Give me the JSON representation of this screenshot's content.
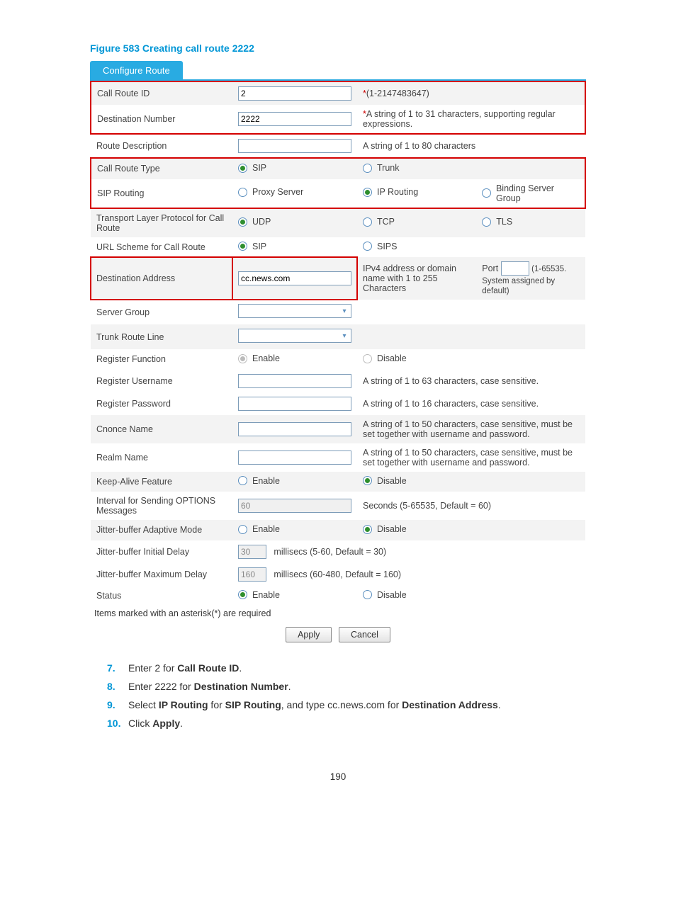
{
  "figure_title": "Figure 583 Creating call route 2222",
  "tab_label": "Configure Route",
  "rows": {
    "call_route_id": {
      "label": "Call Route ID",
      "value": "2",
      "hint_prefix": "*",
      "hint": "(1-2147483647)"
    },
    "dest_number": {
      "label": "Destination Number",
      "value": "2222",
      "hint_prefix": "*",
      "hint": "A string of 1 to 31 characters, supporting regular expressions."
    },
    "route_desc": {
      "label": "Route Description",
      "value": "",
      "hint": "A string of 1 to 80 characters"
    },
    "call_route_type": {
      "label": "Call Route Type",
      "opt1": "SIP",
      "opt2": "Trunk",
      "selected": "SIP"
    },
    "sip_routing": {
      "label": "SIP Routing",
      "opt1": "Proxy Server",
      "opt2": "IP Routing",
      "opt3": "Binding Server Group",
      "selected": "IP Routing"
    },
    "transport": {
      "label": "Transport Layer Protocol for Call Route",
      "opt1": "UDP",
      "opt2": "TCP",
      "opt3": "TLS",
      "selected": "UDP"
    },
    "url_scheme": {
      "label": "URL Scheme for Call Route",
      "opt1": "SIP",
      "opt2": "SIPS",
      "selected": "SIP"
    },
    "dest_addr": {
      "label": "Destination Address",
      "value": "cc.news.com",
      "hint": "IPv4 address or domain name with 1 to 255 Characters",
      "port_label": "Port",
      "port_value": "",
      "port_hint": "(1-65535. System assigned by default)"
    },
    "server_group": {
      "label": "Server Group"
    },
    "trunk_line": {
      "label": "Trunk Route Line"
    },
    "reg_func": {
      "label": "Register Function",
      "opt1": "Enable",
      "opt2": "Disable",
      "selected": "Enable"
    },
    "reg_user": {
      "label": "Register Username",
      "hint": "A string of 1 to 63 characters, case sensitive."
    },
    "reg_pass": {
      "label": "Register Password",
      "hint": "A string of 1 to 16 characters, case sensitive."
    },
    "cnonce": {
      "label": "Cnonce Name",
      "hint": "A string of 1 to 50 characters, case sensitive, must be set together with username and password."
    },
    "realm": {
      "label": "Realm Name",
      "hint": "A string of 1 to 50 characters, case sensitive, must be set together with username and password."
    },
    "keepalive": {
      "label": "Keep-Alive Feature",
      "opt1": "Enable",
      "opt2": "Disable",
      "selected": "Disable"
    },
    "options_int": {
      "label": "Interval for Sending OPTIONS Messages",
      "value": "60",
      "hint": "Seconds (5-65535, Default = 60)"
    },
    "jb_adapt": {
      "label": "Jitter-buffer Adaptive Mode",
      "opt1": "Enable",
      "opt2": "Disable",
      "selected": "Disable"
    },
    "jb_init": {
      "label": "Jitter-buffer Initial Delay",
      "value": "30",
      "hint": "millisecs (5-60, Default = 30)"
    },
    "jb_max": {
      "label": "Jitter-buffer Maximum Delay",
      "value": "160",
      "hint": "millisecs (60-480, Default = 160)"
    },
    "status": {
      "label": "Status",
      "opt1": "Enable",
      "opt2": "Disable",
      "selected": "Enable"
    }
  },
  "footer_note": "Items marked with an asterisk(*) are required",
  "buttons": {
    "apply": "Apply",
    "cancel": "Cancel"
  },
  "steps": {
    "s7a": "Enter 2 for ",
    "s7b": "Call Route ID",
    "s7c": ".",
    "s8a": "Enter 2222 for ",
    "s8b": "Destination Number",
    "s8c": ".",
    "s9a": "Select ",
    "s9b": "IP Routing",
    "s9c": " for ",
    "s9d": "SIP Routing",
    "s9e": ", and type cc.news.com for ",
    "s9f": "Destination Address",
    "s9g": ".",
    "s10a": "Click ",
    "s10b": "Apply",
    "s10c": "."
  },
  "page_number": "190"
}
